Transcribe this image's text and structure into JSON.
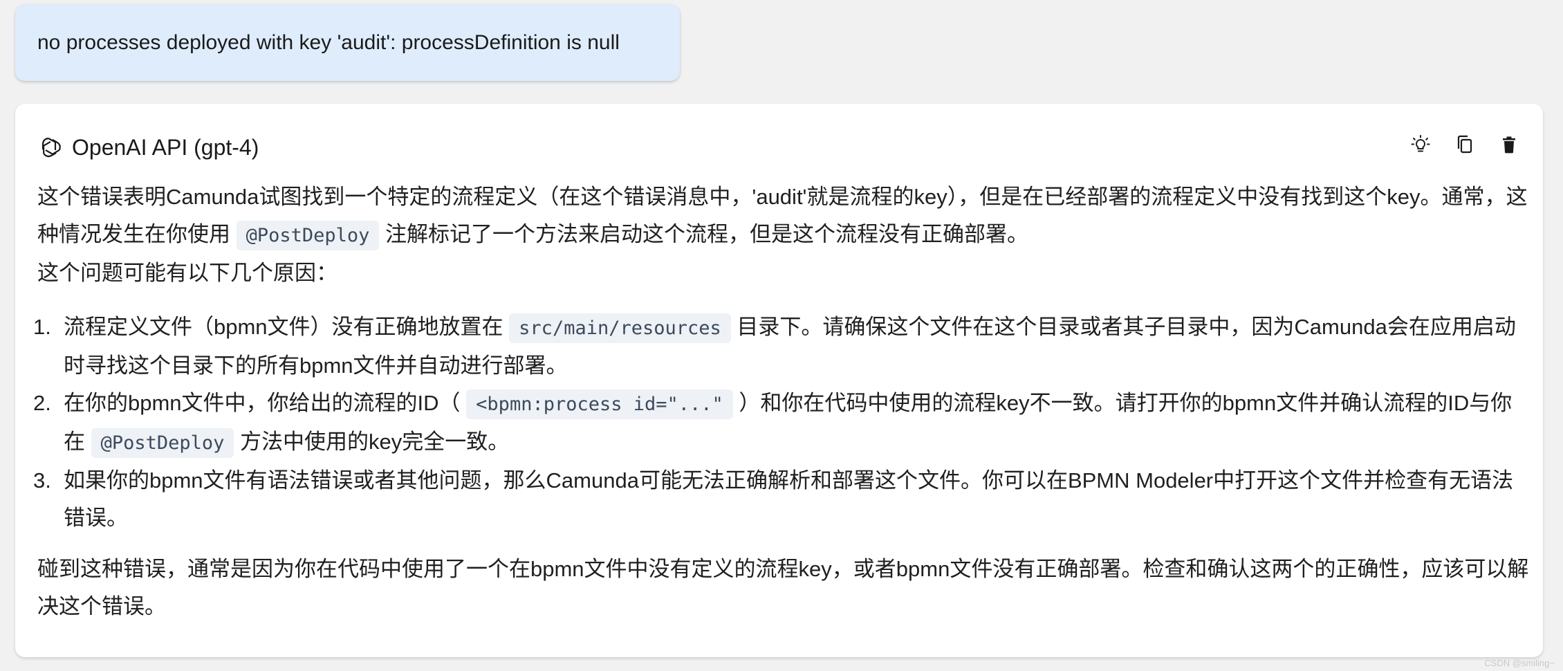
{
  "user_message": {
    "text": "no processes deployed with key 'audit': processDefinition is null"
  },
  "answer": {
    "provider": "OpenAI API (gpt-4)",
    "icons": {
      "logo": "openai-logo-icon",
      "actions": [
        "lightbulb-icon",
        "copy-icon",
        "trash-icon"
      ]
    },
    "intro": {
      "part1": "这个错误表明Camunda试图找到一个特定的流程定义（在这个错误消息中，'audit'就是流程的key），但是在已经部署的流程定义中没有找到这个key。通常，这种情况发生在你使用",
      "code1": "@PostDeploy",
      "part2": "注解标记了一个方法来启动这个流程，但是这个流程没有正确部署。"
    },
    "lead": "这个问题可能有以下几个原因：",
    "reasons": [
      {
        "num": "1.",
        "before": "流程定义文件（bpmn文件）没有正确地放置在",
        "code": "src/main/resources",
        "after": "目录下。请确保这个文件在这个目录或者其子目录中，因为Camunda会在应用启动时寻找这个目录下的所有bpmn文件并自动进行部署。"
      },
      {
        "num": "2.",
        "before": "在你的bpmn文件中，你给出的流程的ID（",
        "code": "<bpmn:process id=\"...\"",
        "middle": "）和你在代码中使用的流程key不一致。请打开你的bpmn文件并确认流程的ID与你在",
        "code2": "@PostDeploy",
        "after": "方法中使用的key完全一致。"
      },
      {
        "num": "3.",
        "text": "如果你的bpmn文件有语法错误或者其他问题，那么Camunda可能无法正确解析和部署这个文件。你可以在BPMN Modeler中打开这个文件并检查有无语法错误。"
      }
    ],
    "closing": "碰到这种错误，通常是因为你在代码中使用了一个在bpmn文件中没有定义的流程key，或者bpmn文件没有正确部署。检查和确认这两个的正确性，应该可以解决这个错误。"
  },
  "watermark": "CSDN @smiling~"
}
